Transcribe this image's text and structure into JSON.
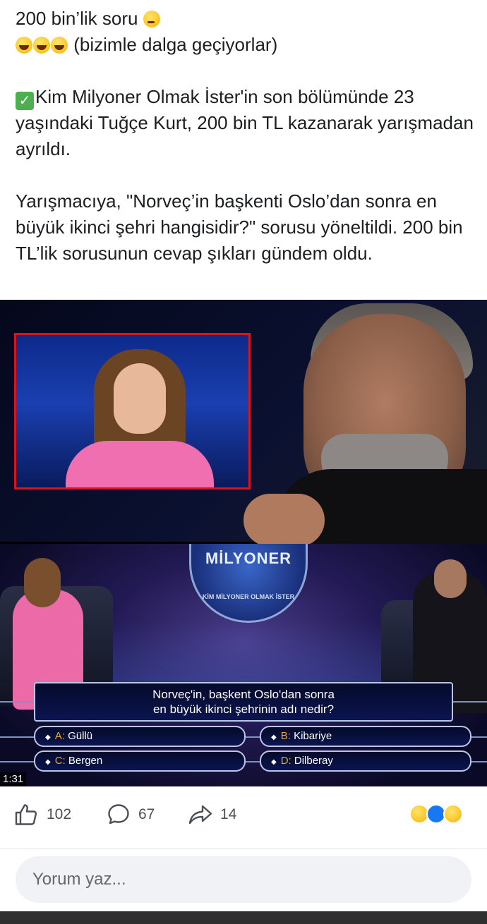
{
  "post": {
    "line1": "200 bin’lik soru",
    "line2": "(bizimle dalga geçiyorlar)",
    "para1": "Kim Milyoner Olmak İster'in son bölümünde 23 yaşındaki Tuğçe Kurt, 200 bin TL kazanarak yarışmadan ayrıldı.",
    "para2": "Yarışmacıya, \"Norveç’in başkenti Oslo’dan sonra en büyük ikinci şehri hangisidir?\" sorusu yöneltildi. 200 bin TL’lik sorusunun cevap şıkları gündem oldu.",
    "icons": [
      "thinking-face-emoji",
      "rofl-emoji",
      "check-mark-emoji"
    ]
  },
  "video": {
    "logo": "MİLYONER",
    "logo_arc": "KİM MİLYONER OLMAK İSTER",
    "question_line1": "Norveç'in, başkent Oslo'dan sonra",
    "question_line2": "en büyük ikinci şehrinin adı nedir?",
    "answers": [
      {
        "key": "A:",
        "text": "Güllü"
      },
      {
        "key": "B:",
        "text": "Kibariye"
      },
      {
        "key": "C:",
        "text": "Bergen"
      },
      {
        "key": "D:",
        "text": "Dilberay"
      }
    ],
    "timestamp": "1:31",
    "highlight_color": "#d8141c"
  },
  "actions": {
    "likes": "102",
    "comments": "67",
    "shares": "14",
    "reactions": [
      "haha",
      "like",
      "wow"
    ]
  },
  "comment_box": {
    "placeholder": "Yorum yaz..."
  }
}
